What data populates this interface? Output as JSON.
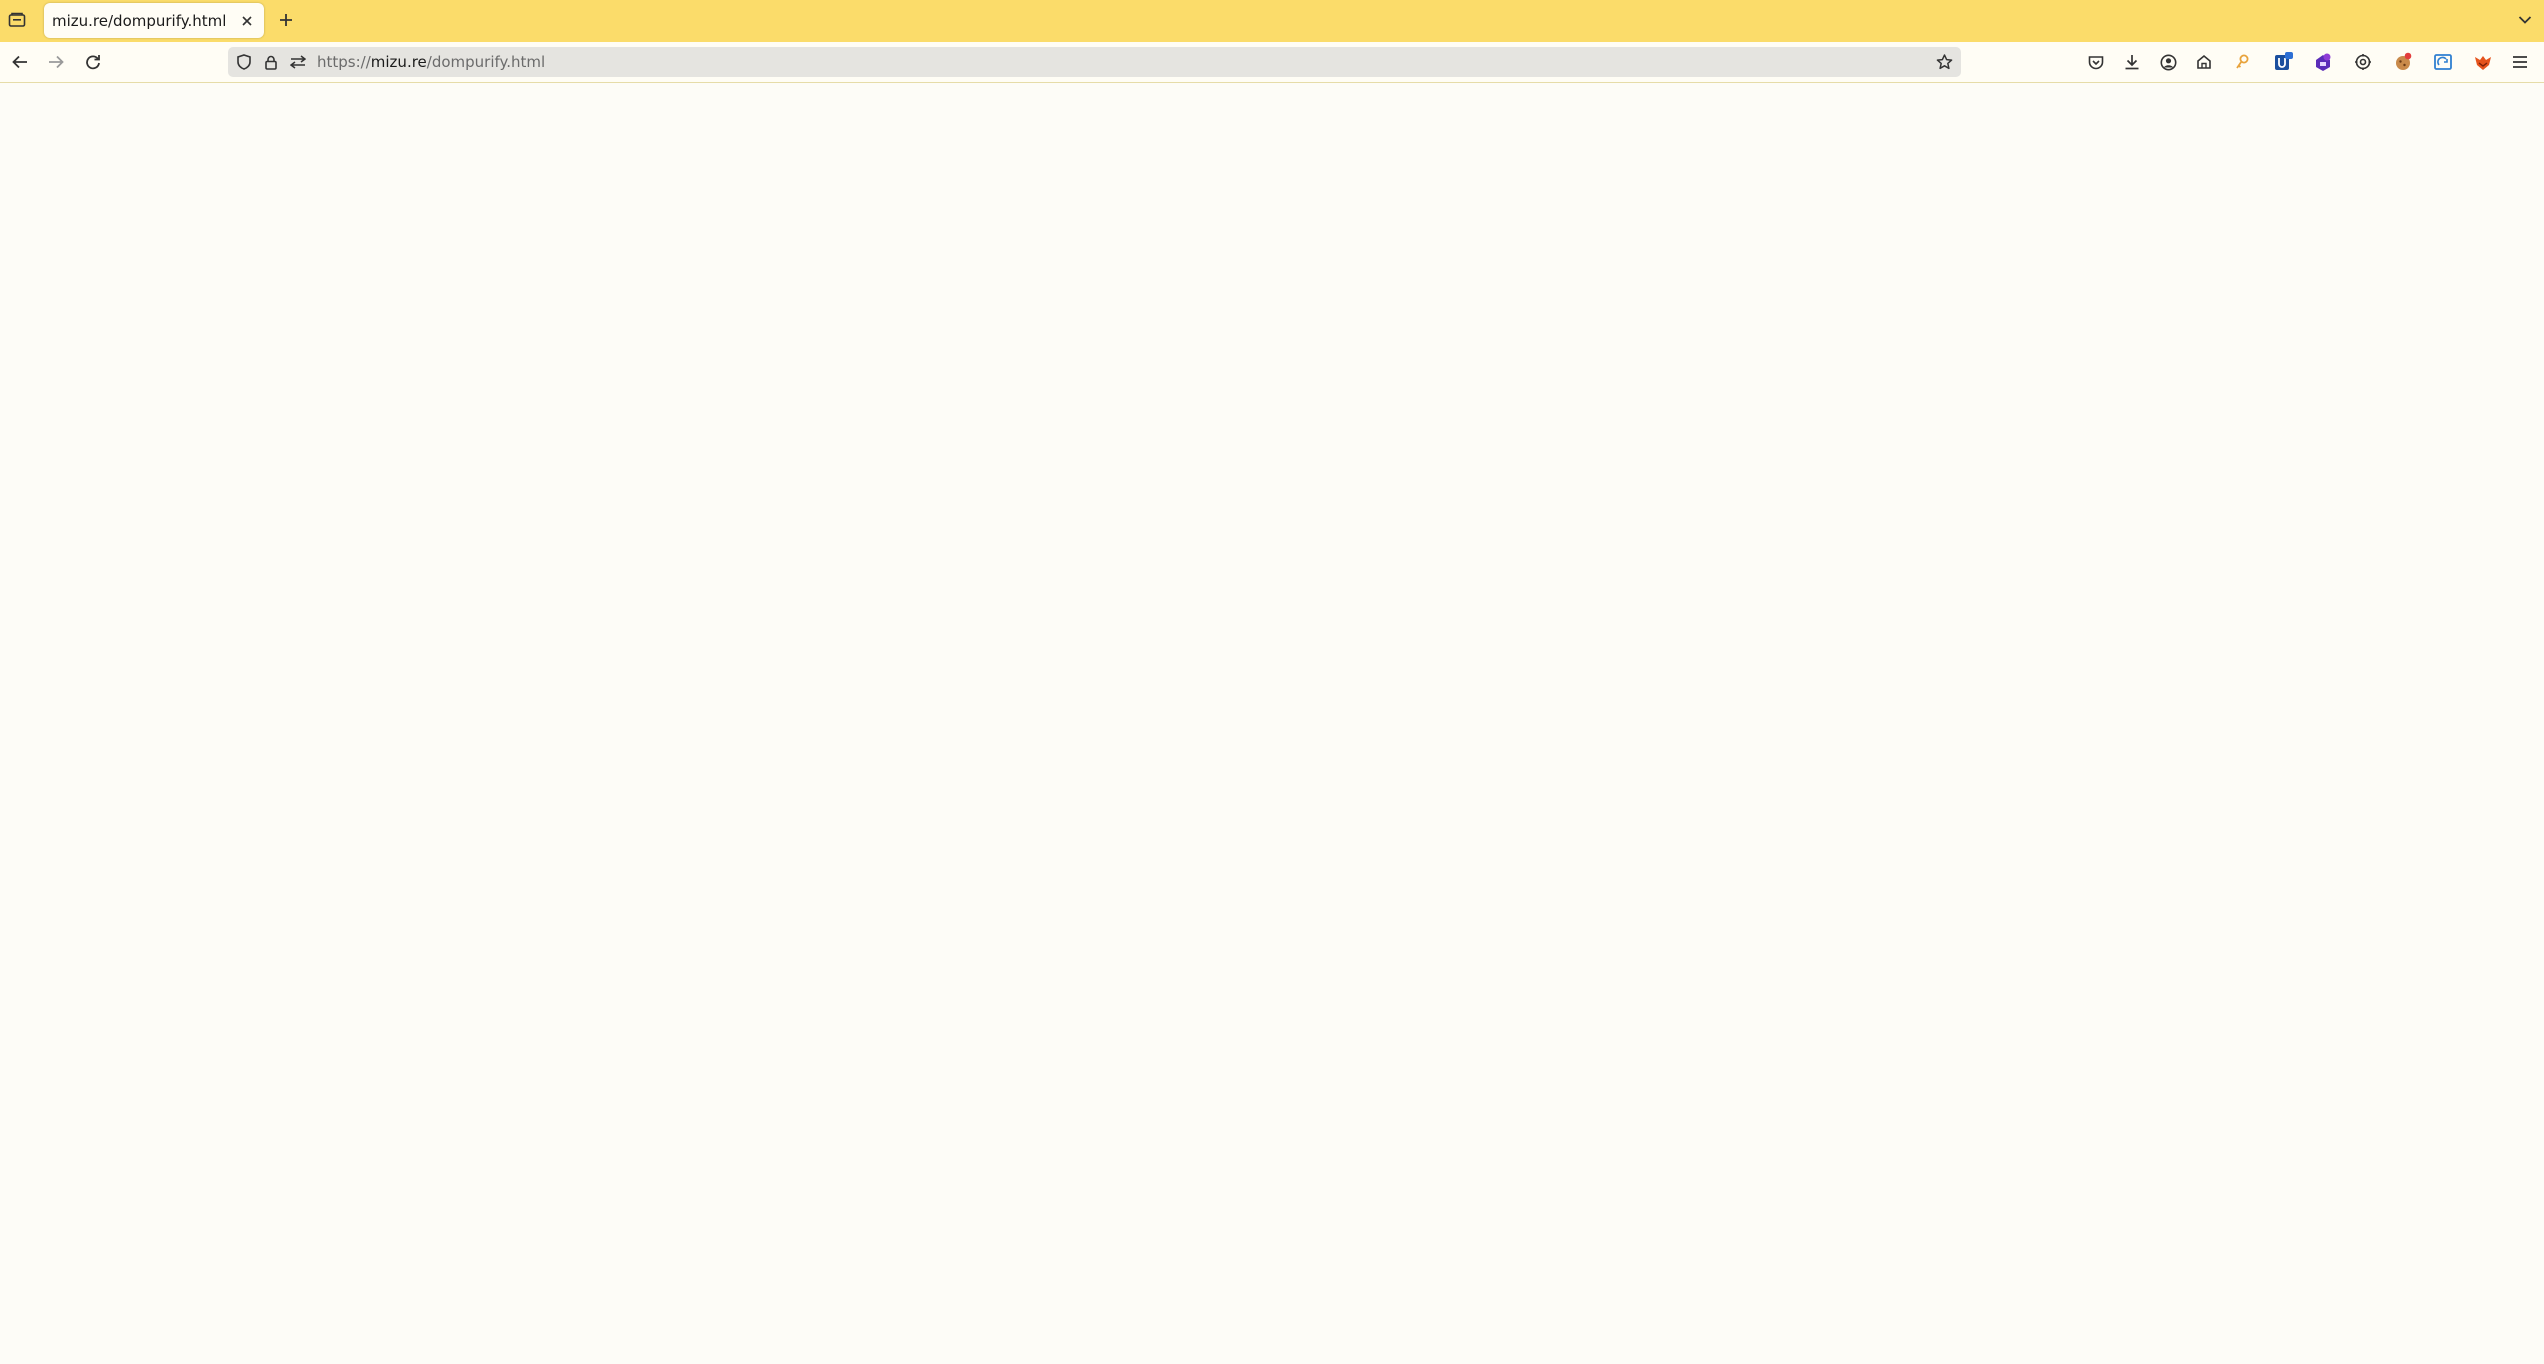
{
  "browser": {
    "tab": {
      "title": "mizu.re/dompurify.html"
    },
    "url": {
      "scheme": "https://",
      "host": "mizu.re",
      "path": "/dompurify.html"
    },
    "icons": {
      "tab_list": "folder-tabs-icon",
      "close": "close-icon",
      "new_tab": "plus-icon",
      "all_tabs": "chevron-down-icon",
      "back": "back-arrow-icon",
      "forward": "forward-arrow-icon",
      "reload": "reload-icon",
      "tracking": "shield-icon",
      "lock": "lock-icon",
      "permissions": "permissions-icon",
      "bookmark": "star-icon"
    },
    "toolbar": [
      "pocket-icon",
      "download-icon",
      "account-icon",
      "extensions-icon",
      "key-icon",
      "extension-u-icon",
      "extension-purple-icon",
      "settings-gear-icon",
      "extension-cookie-icon",
      "extension-sync-icon",
      "extension-fox-icon",
      "menu-icon"
    ],
    "colors": {
      "tabbar": "#fbdc6a",
      "page": "#fdfcf7"
    }
  }
}
